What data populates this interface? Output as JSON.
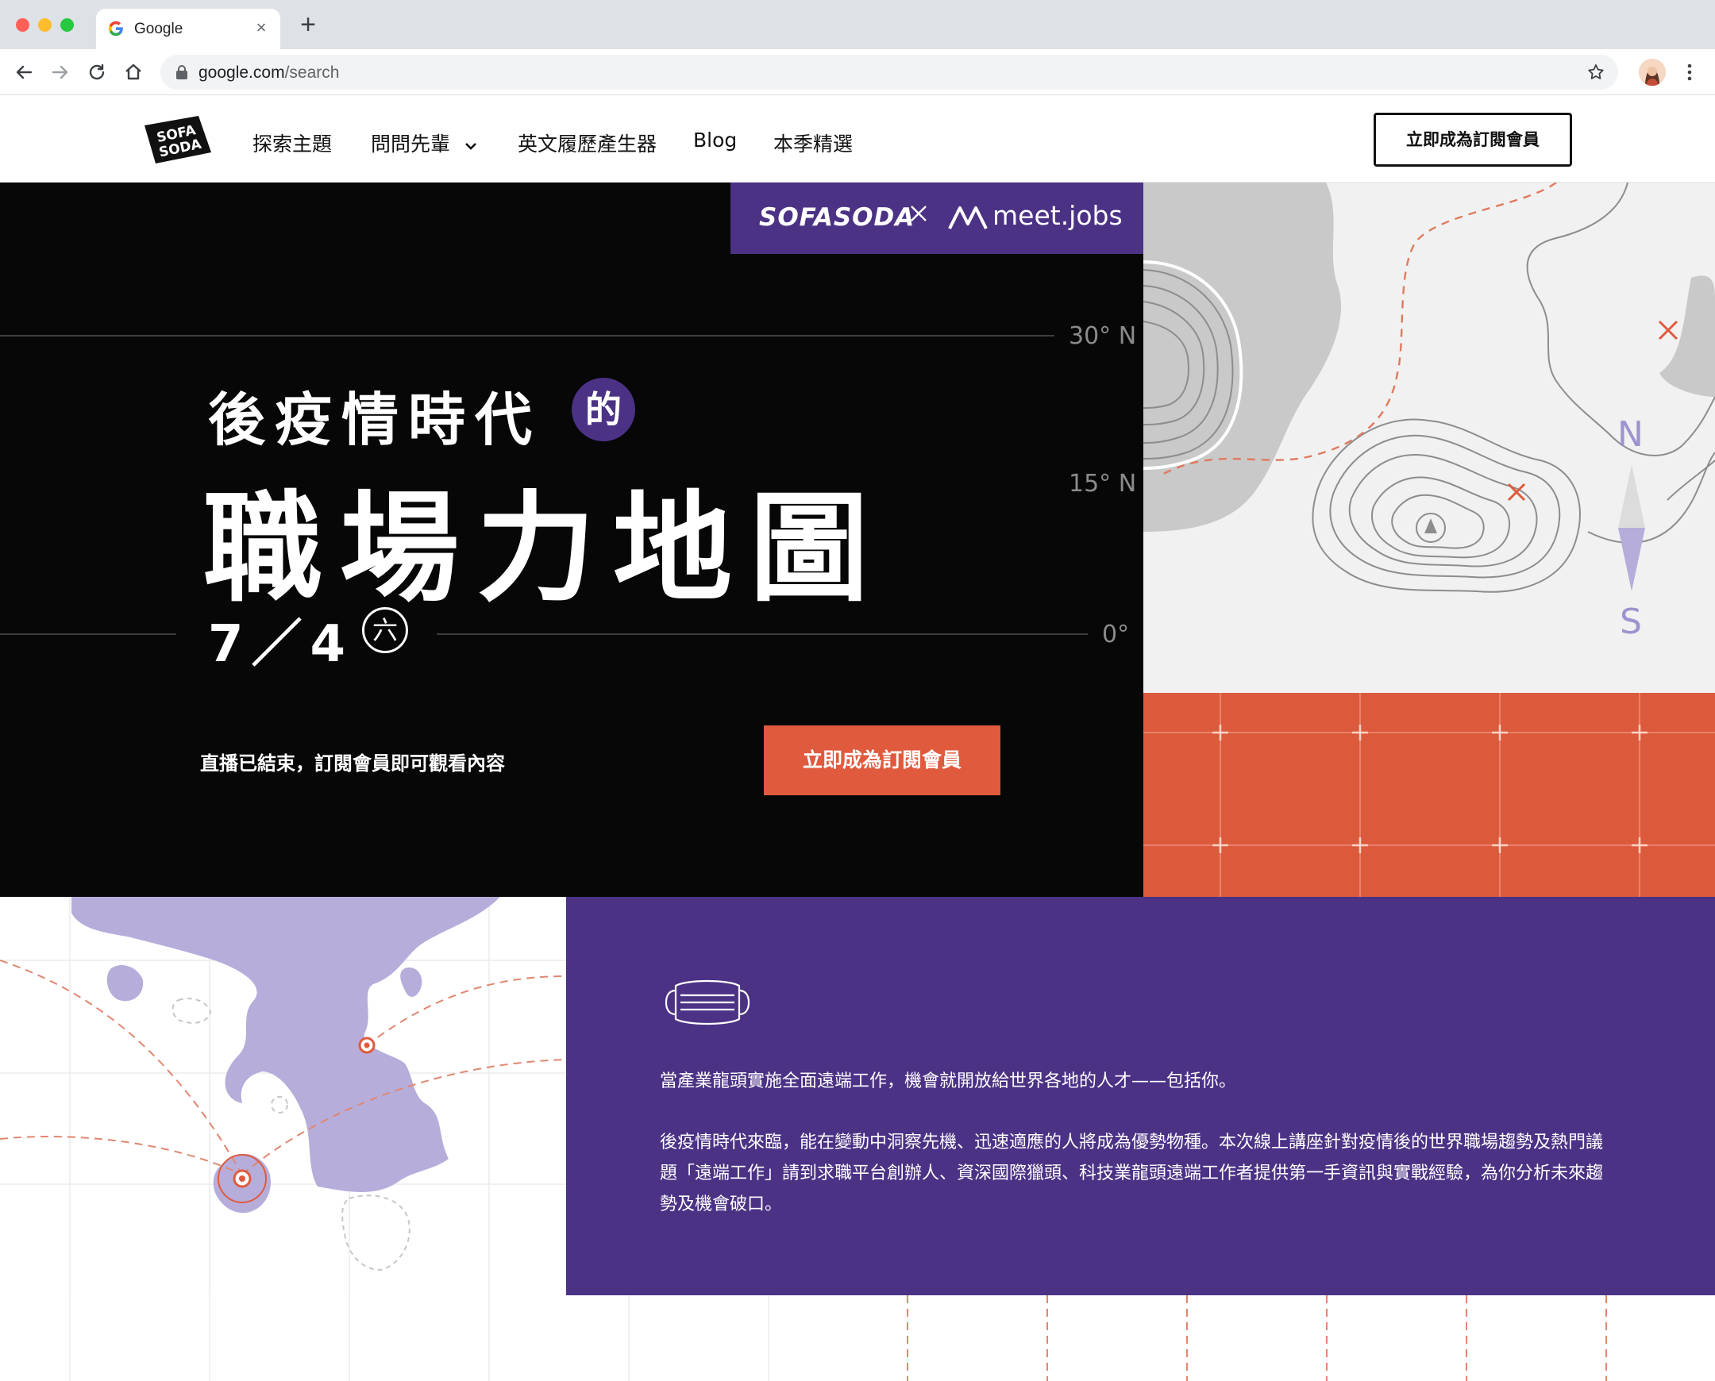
{
  "browser": {
    "tab_title": "Google",
    "new_tab_symbol": "+",
    "close_symbol": "×",
    "url_host": "google.com",
    "url_path": "/search"
  },
  "header": {
    "logo_text": "SOFA SODA",
    "nav": [
      {
        "label": "探索主題"
      },
      {
        "label": "問問先輩",
        "has_dropdown": true
      },
      {
        "label": "英文履歷產生器"
      },
      {
        "label": "Blog"
      },
      {
        "label": "本季精選"
      }
    ],
    "cta_label": "立即成為訂閱會員"
  },
  "hero": {
    "partner_left": "SOFASODA",
    "partner_right": "meet.jobs",
    "latitude_labels": [
      "30° N",
      "15° N",
      "0°"
    ],
    "subtitle": "後疫情時代",
    "subtitle_badge": "的",
    "title": "職場力地圖",
    "date": "7／4",
    "day": "六",
    "note": "直播已結束，訂閱會員即可觀看內容",
    "cta_label": "立即成為訂閱會員",
    "compass_n": "N",
    "compass_s": "S"
  },
  "info": {
    "paragraph1": "當產業龍頭實施全面遠端工作，機會就開放給世界各地的人才——包括你。",
    "paragraph2": "後疫情時代來臨，能在變動中洞察先機、迅速適應的人將成為優勢物種。本次線上講座針對疫情後的世界職場趨勢及熱門議題「遠端工作」請到求職平台創辦人、資深國際獵頭、科技業龍頭遠端工作者提供第一手資訊與實戰經驗，為你分析未來趨勢及機會破口。"
  },
  "colors": {
    "purple": "#4b3285",
    "orange": "#dc5a3c",
    "lavender": "#b6addb",
    "black": "#070707"
  }
}
